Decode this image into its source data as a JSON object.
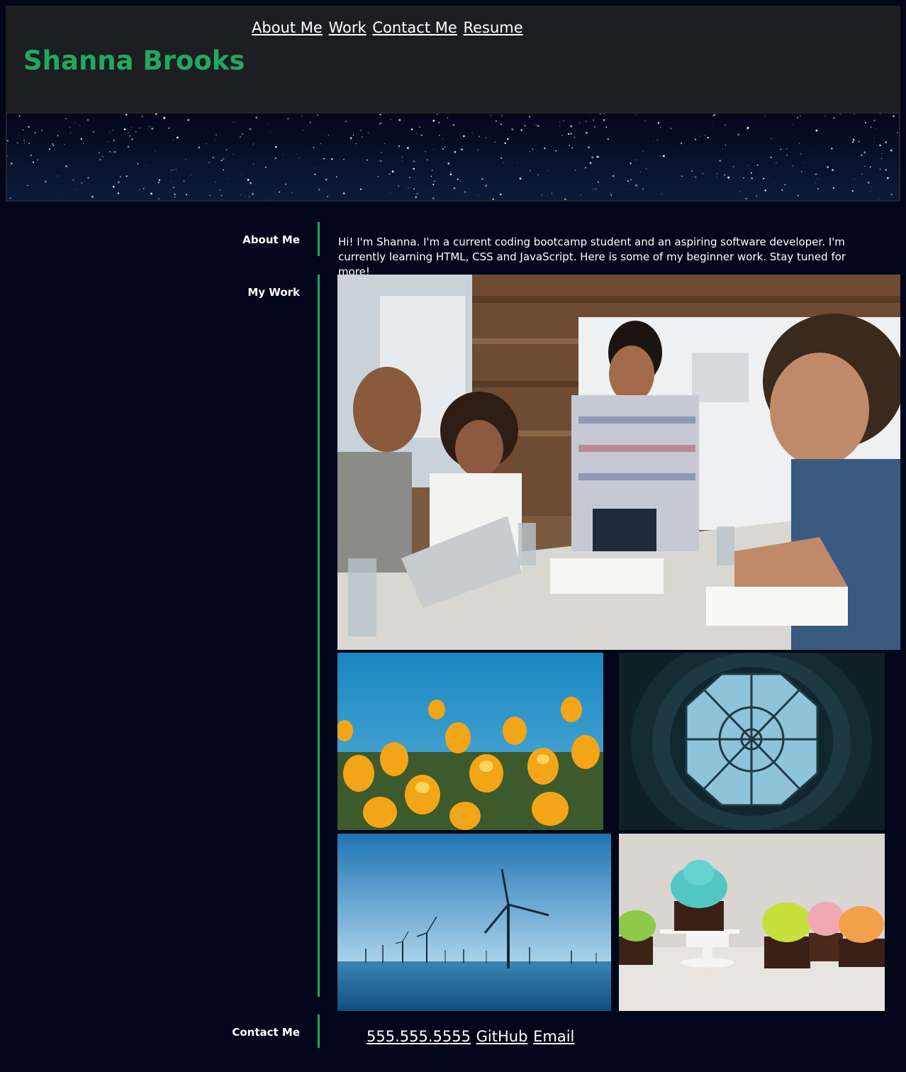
{
  "header": {
    "name": "Shanna Brooks",
    "nav": [
      "About Me",
      "Work",
      "Contact Me",
      "Resume"
    ]
  },
  "about": {
    "label": "About Me",
    "text": "Hi! I'm Shanna. I'm a current coding bootcamp student and an aspiring software developer. I'm currently learning HTML, CSS and JavaScript. Here is some of my beginner work. Stay tuned for more!"
  },
  "work": {
    "label": "My Work"
  },
  "contact": {
    "label": "Contact Me",
    "links": [
      "555.555.5555",
      "GitHub",
      "Email"
    ]
  },
  "colors": {
    "accent": "#21a861",
    "background": "#01061a",
    "header_bg": "#1d1e22"
  }
}
